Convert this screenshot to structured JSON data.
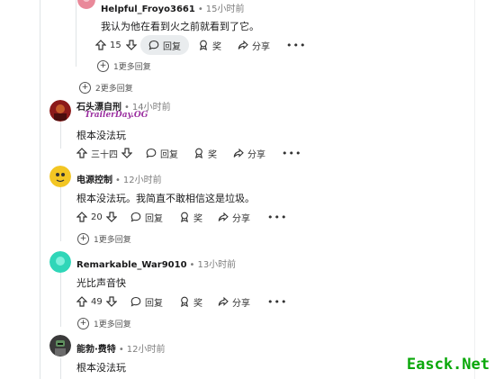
{
  "comments": [
    {
      "author": "Helpful_Froyo3661",
      "time": "15小时前",
      "text": "我认为他在看到火之前就看到了它。",
      "votes": "15",
      "reply_label": "回复",
      "award_label": "奖",
      "share_label": "分享",
      "more_replies": "1更多回复"
    },
    {
      "author": "石头漂自刑",
      "time": "14小时前",
      "flair": "TrailerDay.OG",
      "text": "根本没法玩",
      "votes": "三十四",
      "reply_label": "回复",
      "award_label": "奖",
      "share_label": "分享"
    },
    {
      "author": "电源控制",
      "time": "12小时前",
      "text": "根本没法玩。我简直不敢相信这是垃圾。",
      "votes": "20",
      "reply_label": "回复",
      "award_label": "奖",
      "share_label": "分享",
      "more_replies": "1更多回复"
    },
    {
      "author": "Remarkable_War9010",
      "time": "13小时前",
      "text": "光比声音快",
      "votes": "49",
      "reply_label": "回复",
      "award_label": "奖",
      "share_label": "分享",
      "more_replies": "1更多回复"
    },
    {
      "author": "能勃·费特",
      "time": "12小时前",
      "text": "根本没法玩"
    }
  ],
  "thread": {
    "more_replies": "2更多回复"
  },
  "dot": "•",
  "watermark": "Easck.Net",
  "colors": {
    "avatar_1": "#e9899a",
    "avatar_2": "#8b1a1a",
    "avatar_3": "#f3c623",
    "avatar_4": "#2fd6b8",
    "avatar_5": "#3a3a3a",
    "flair": "#9b2fa0",
    "watermark": "#0aa80a"
  }
}
